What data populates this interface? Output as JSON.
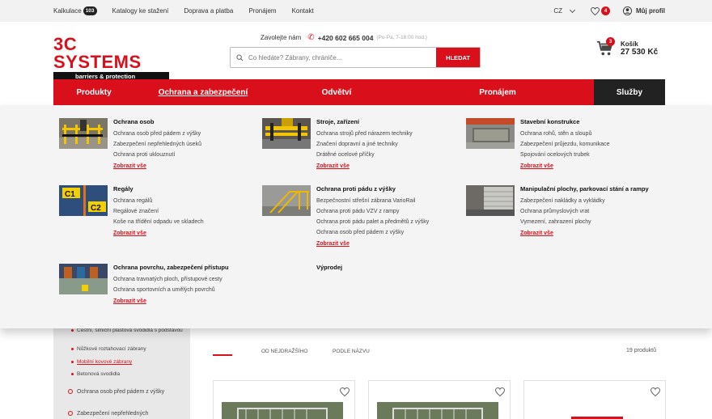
{
  "topbar": {
    "links": [
      {
        "label": "Kalkulace",
        "badge": "103"
      },
      {
        "label": "Katalogy ke stažení"
      },
      {
        "label": "Doprava a platba"
      },
      {
        "label": "Pronájem"
      },
      {
        "label": "Kontakt"
      }
    ],
    "language": "CZ",
    "favorites_count": "4",
    "profile_label": "Můj profil"
  },
  "header": {
    "logo_title": "3C SYSTEMS",
    "logo_subtitle": "barriers & protection",
    "call_prefix": "Zavolejte nám",
    "phone": "+420 602 665 004",
    "hours": "(Po-Pa, 7-18:00 hod.)",
    "search_placeholder": "Co hledáte? Zábrany, chrániče...",
    "search_button": "HLEDAT",
    "cart_count": "3",
    "cart_label": "Košík",
    "cart_total": "27 530 Kč"
  },
  "nav": [
    {
      "label": "Produkty"
    },
    {
      "label": "Ochrana a zabezpečení"
    },
    {
      "label": "Odvětví"
    },
    {
      "label": "Pronájem"
    },
    {
      "label": "Služby"
    }
  ],
  "mega": {
    "categories": [
      {
        "title": "Ochrana osob",
        "items": [
          "Ochrana osob před pádem z výšky",
          "Zabezpečení nepřehledných úseků",
          "Ochrana proti uklouznutí"
        ],
        "more": "Zobrazit vše"
      },
      {
        "title": "Stroje, zařízení",
        "items": [
          "Ochrana strojů před nárazem techniky",
          "Značení dopravní a jiné techniky",
          "Drátěné ocelové příčky"
        ],
        "more": "Zobrazit vše"
      },
      {
        "title": "Stavební konstrukce",
        "items": [
          "Ochrana rohů, stěn a sloupů",
          "Zabezpečení průjezdu, komunikace",
          "Spojování ocelových trubek"
        ],
        "more": "Zobrazit vše"
      },
      {
        "title": "Regály",
        "items": [
          "Ochrana regálů",
          "Regálové značení",
          "Koše na třídění odpadu ve skladech"
        ],
        "more": "Zobrazit vše"
      },
      {
        "title": "Ochrana proti pádu z výšky",
        "items": [
          "Bezpečnostní střešní zábrana VarioRail",
          "Ochrana proti pádu VZV z rampy",
          "Ochrana proti pádu palet a předmětů z výšky",
          "Ochrana osob před pádem z výšky"
        ],
        "more": "Zobrazit vše"
      },
      {
        "title": "Manipulační plochy, parkovací stání a rampy",
        "items": [
          "Zabezpečení nakládky a vykládky",
          "Ochrana průmyslových vrat",
          "Vymezení, zahrazení plochy"
        ],
        "more": "Zobrazit vše"
      },
      {
        "title": "Ochrana povrchu, zabezpečení přístupu",
        "items": [
          "Ochrana travnatých ploch, přístupové cesty",
          "Ochrana sportovních a umělých povrchů"
        ],
        "more": "Zobrazit vše"
      },
      {
        "title": "Výprodej",
        "items": [],
        "more": ""
      }
    ]
  },
  "sidebar": {
    "items": [
      "Cestní, silniční plastová svodidla s podstavou",
      "Nůžkové roztahovací zábrany",
      "Mobilní kovové zábrany",
      "Betonová svodidla"
    ],
    "groups": [
      "Ochrana osob před pádem z výšky",
      "Zabezpečení nepřehledných"
    ]
  },
  "listing": {
    "sort_options": [
      "OD NEJDRAŽŠÍHO",
      "PODLE NÁZVU"
    ],
    "count": "19 produktů"
  },
  "colors": {
    "brand_red": "#d9101b",
    "dark": "#222222"
  }
}
